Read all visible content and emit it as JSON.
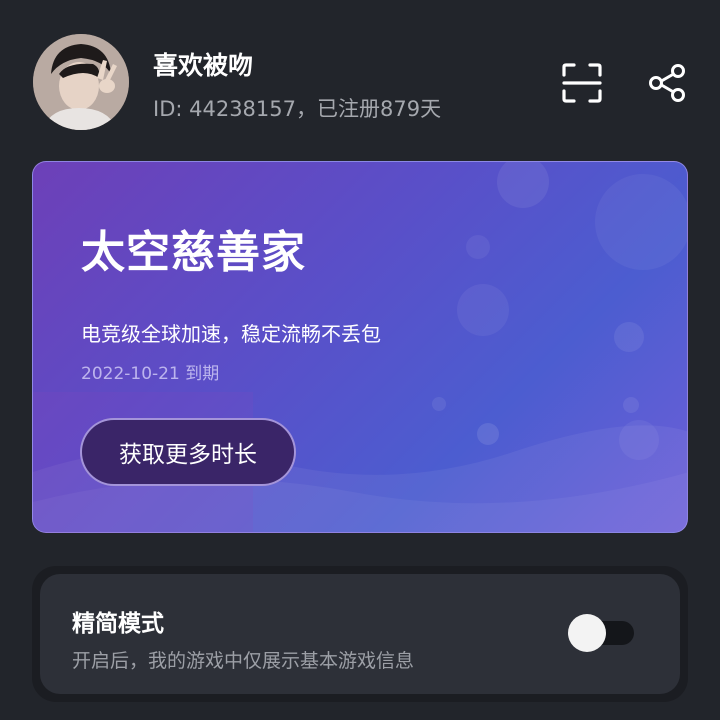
{
  "profile": {
    "username": "喜欢被吻",
    "info": "ID: 44238157，已注册879天"
  },
  "header": {
    "scan_icon": "scan-icon",
    "share_icon": "share-icon"
  },
  "promo": {
    "title": "太空慈善家",
    "subtitle": "电竞级全球加速，稳定流畅不丢包",
    "expiry": "2022-10-21 到期",
    "button_label": "获取更多时长",
    "accent_color": "#5a4fc8"
  },
  "simple_mode": {
    "title": "精简模式",
    "description": "开启后，我的游戏中仅展示基本游戏信息",
    "enabled": false
  }
}
